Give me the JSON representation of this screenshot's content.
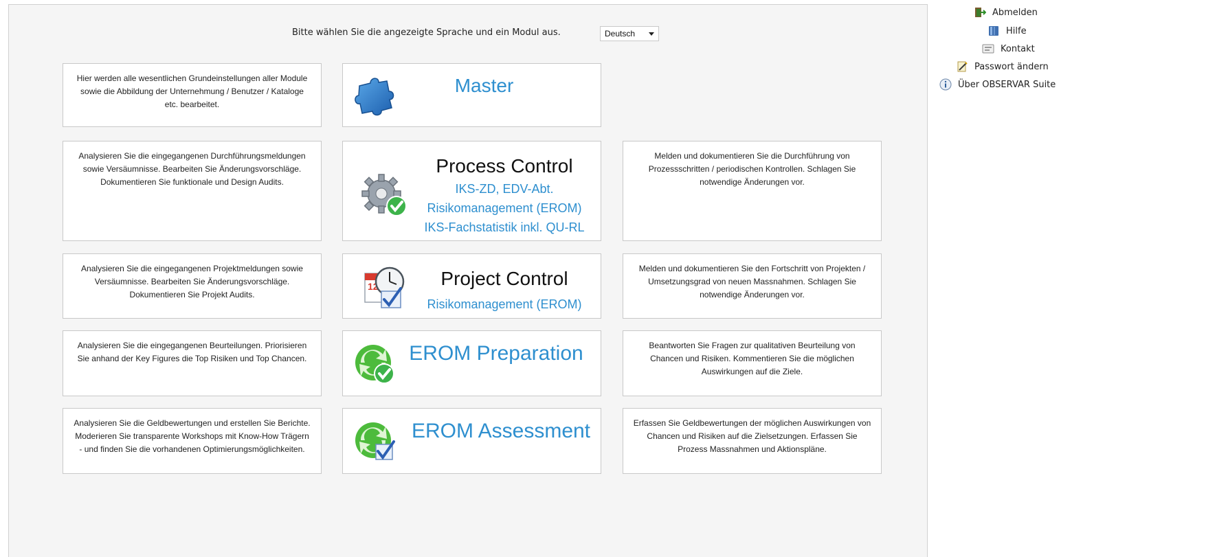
{
  "header": {
    "prompt": "Bitte wählen Sie die angezeigte Sprache und ein Modul aus.",
    "language_selected": "Deutsch"
  },
  "modules": [
    {
      "title": "Master",
      "subtitles": [],
      "left_desc": "Hier werden alle wesentlichen Grundeinstellungen aller Module sowie die Abbildung der Unternehmung / Benutzer / Kataloge etc. bearbeitet.",
      "right_desc": ""
    },
    {
      "title": "Process Control",
      "subtitles": [
        "IKS-ZD, EDV-Abt.",
        "Risikomanagement (EROM)",
        "IKS-Fachstatistik inkl. QU-RL"
      ],
      "left_desc": "Analysieren Sie die eingegangenen Durchführungsmeldungen sowie Versäumnisse. Bearbeiten Sie Änderungsvorschläge. Dokumentieren Sie funktionale und Design Audits.",
      "right_desc": "Melden und dokumentieren Sie die Durchführung von Prozessschritten / periodischen Kontrollen. Schlagen Sie notwendige Änderungen vor."
    },
    {
      "title": "Project Control",
      "subtitles": [
        "Risikomanagement (EROM)"
      ],
      "left_desc": "Analysieren Sie die eingegangenen Projektmeldungen sowie Versäumnisse. Bearbeiten Sie Änderungsvorschläge. Dokumentieren Sie Projekt Audits.",
      "right_desc": "Melden und dokumentieren Sie den Fortschritt von Projekten / Umsetzungsgrad von neuen Massnahmen. Schlagen Sie notwendige Änderungen vor."
    },
    {
      "title": "EROM Preparation",
      "subtitles": [],
      "left_desc": "Analysieren Sie die eingegangenen Beurteilungen. Priorisieren Sie anhand der Key Figures die Top Risiken und Top Chancen.",
      "right_desc": "Beantworten Sie Fragen zur qualitativen Beurteilung von Chancen und Risiken. Kommentieren Sie die möglichen Auswirkungen auf die Ziele."
    },
    {
      "title": "EROM Assessment",
      "subtitles": [],
      "left_desc": "Analysieren Sie die Geldbewertungen und erstellen Sie Berichte. Moderieren Sie transparente Workshops mit Know-How Trägern - und finden Sie die vorhandenen Optimierungsmöglichkeiten.",
      "right_desc": "Erfassen Sie Geldbewertungen der möglichen Auswirkungen von Chancen und Risiken auf die Zielsetzungen. Erfassen Sie Prozess Massnahmen und Aktionspläne."
    }
  ],
  "sidebar": {
    "items": [
      {
        "label": "Abmelden",
        "icon": "logout-icon"
      },
      {
        "label": "Hilfe",
        "icon": "help-book-icon"
      },
      {
        "label": "Kontakt",
        "icon": "contact-card-icon"
      },
      {
        "label": "Passwort ändern",
        "icon": "password-edit-icon"
      },
      {
        "label": "Über OBSERVAR Suite",
        "icon": "info-icon"
      }
    ]
  },
  "colors": {
    "accent_blue": "#2e8fcf",
    "panel_bg": "#f5f5f5",
    "border": "#c8c8c8"
  }
}
